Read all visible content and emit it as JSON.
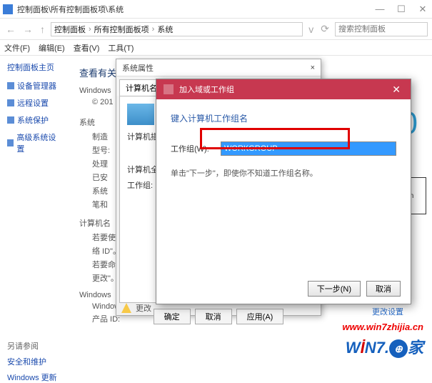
{
  "titlebar": {
    "title": "控制面板\\所有控制面板项\\系统"
  },
  "nav": {
    "crumb1": "控制面板",
    "crumb2": "所有控制面板项",
    "crumb3": "系统",
    "search_placeholder": "搜索控制面板"
  },
  "menubar": {
    "file": "文件(F)",
    "edit": "编辑(E)",
    "view": "查看(V)",
    "tools": "工具(T)"
  },
  "sidebar": {
    "home": "控制面板主页",
    "items": [
      {
        "label": "设备管理器"
      },
      {
        "label": "远程设置"
      },
      {
        "label": "系统保护"
      },
      {
        "label": "高级系统设置"
      }
    ],
    "also_header": "另请参阅",
    "also_items": [
      "安全和维护",
      "Windows 更新"
    ]
  },
  "main": {
    "heading": "查看有关计算机的基本信息",
    "win_edition_label": "Windows",
    "copyright": "© 201",
    "big": "0",
    "system_label": "系统",
    "system_rows": [
      "制造",
      "型号:",
      "处理",
      "已安",
      "系统",
      "笔和"
    ],
    "brand_text": "tem",
    "name_section": "计算机名",
    "name_rows": [
      "若要使用",
      "络 ID\"。",
      "",
      "若要命名证",
      "更改\"。"
    ],
    "activation_label": "Windows",
    "activation_rows": [
      "Windows",
      "产品 ID:"
    ],
    "change_link": "更改设置"
  },
  "sysprops": {
    "title": "系统属性",
    "close": "×",
    "tab": "计算机名",
    "desc_label": "计算机描述",
    "full_label": "计算机全部",
    "workgroup_label": "工作组:",
    "btn_ok": "确定",
    "btn_cancel": "取消",
    "btn_apply": "应用(A)"
  },
  "joindlg": {
    "title": "加入域或工作组",
    "heading": "键入计算机工作组名",
    "field_label": "工作组(W):",
    "field_value": "WORKGROUP",
    "hint": "单击\"下一步\"，即使你不知道工作组名称。",
    "btn_next": "下一步(N)",
    "btn_cancel": "取消"
  },
  "warn": {
    "text": "更改"
  },
  "watermark": {
    "url": "www.win7zhijia.cn",
    "logo_w": "W",
    "logo_i": "İ",
    "logo_n": "N",
    "logo_7": "7.",
    "logo_tail": "家"
  }
}
